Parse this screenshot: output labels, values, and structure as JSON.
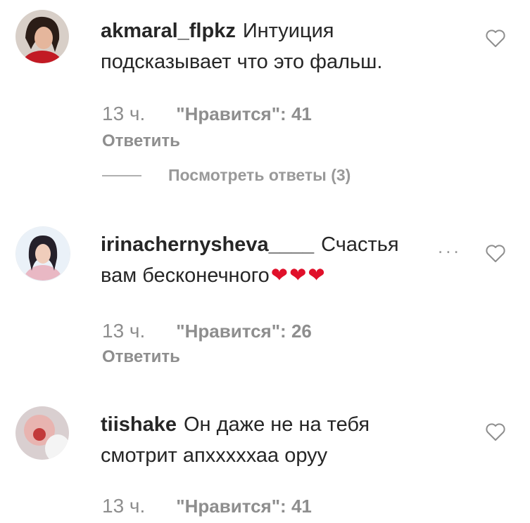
{
  "comments": [
    {
      "username": "akmaral_flpkz",
      "text": "Интуиция подсказывает что это фальш.",
      "time": "13 ч.",
      "likes": "\"Нравится\": 41",
      "reply": "Ответить",
      "view_replies": "Посмотреть ответы (3)"
    },
    {
      "username": "irinachernysheva____",
      "text": "Счастья вам бесконечного",
      "hearts": "❤❤❤",
      "more": "...",
      "time": "13 ч.",
      "likes": "\"Нравится\": 26",
      "reply": "Ответить"
    },
    {
      "username": "tiishake",
      "text": "Он даже не на тебя смотрит апхххххаа оруу",
      "time": "13 ч.",
      "likes": "\"Нравится\": 41"
    }
  ],
  "icons": {
    "like": "heart-outline-icon",
    "more": "more-dots-icon"
  }
}
